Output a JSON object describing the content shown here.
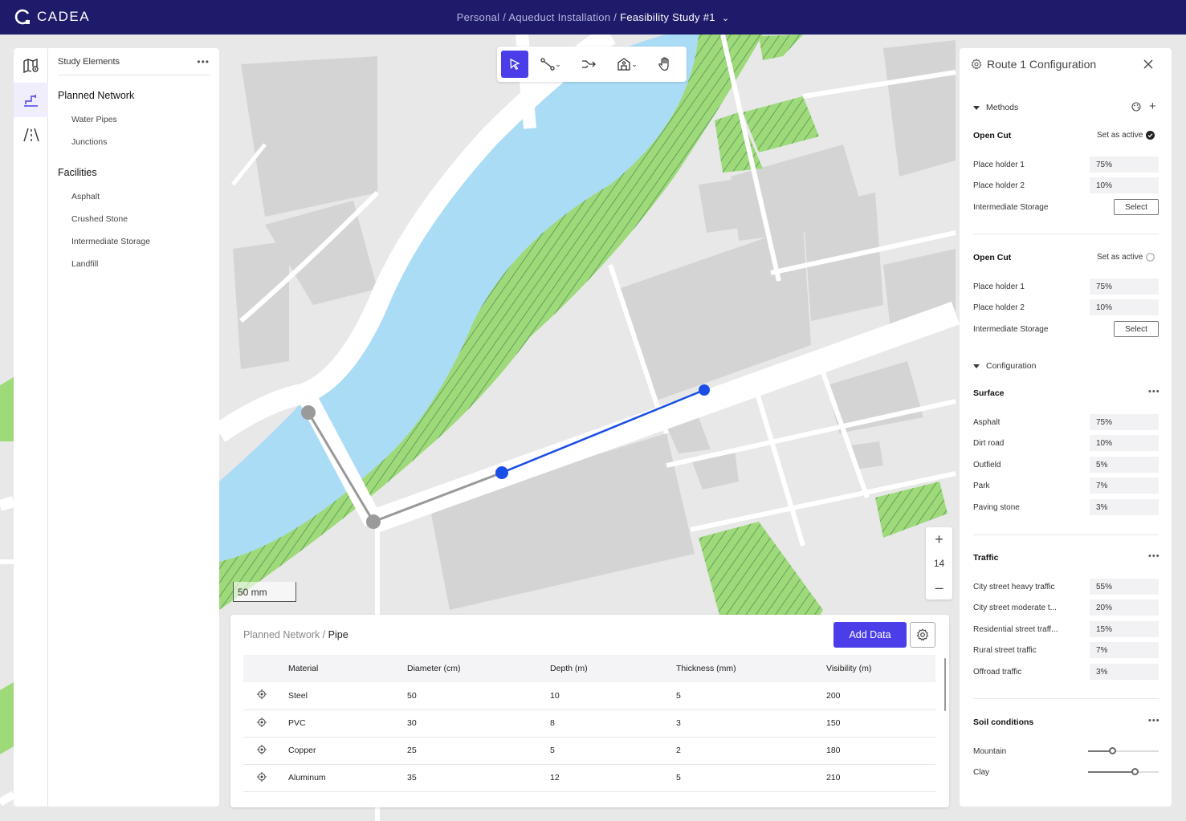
{
  "app": {
    "brand": "CADEA"
  },
  "breadcrumb": {
    "part1": "Personal",
    "sep": " / ",
    "part2": "Aqueduct Installation",
    "current": "Feasibility Study #1"
  },
  "study": {
    "title": "Study Elements",
    "groups": [
      {
        "label": "Planned Network",
        "items": [
          "Water Pipes",
          "Junctions"
        ]
      },
      {
        "label": "Facilities",
        "items": [
          "Asphalt",
          "Crushed Stone",
          "Intermediate Storage",
          "Landfill"
        ]
      }
    ]
  },
  "map": {
    "zoom_level": "14",
    "scale_label": "50 mm"
  },
  "data_panel": {
    "crumb_parent": "Planned Network",
    "crumb_sep": " / ",
    "crumb_current": "Pipe",
    "add_label": "Add Data",
    "columns": [
      "Material",
      "Diameter (cm)",
      "Depth (m)",
      "Thickness (mm)",
      "Visibility (m)"
    ],
    "rows": [
      [
        "Steel",
        "50",
        "10",
        "5",
        "200"
      ],
      [
        "PVC",
        "30",
        "8",
        "3",
        "150"
      ],
      [
        "Copper",
        "25",
        "5",
        "2",
        "180"
      ],
      [
        "Aluminum",
        "35",
        "12",
        "5",
        "210"
      ]
    ]
  },
  "config": {
    "title": "Route 1 Configuration",
    "methods_label": "Methods",
    "methods": [
      {
        "name": "Open Cut",
        "active_label": "Set as active",
        "active": true,
        "ph1_label": "Place holder 1",
        "ph1": "75%",
        "ph2_label": "Place holder 2",
        "ph2": "10%",
        "storage_label": "Intermediate Storage",
        "select_label": "Select"
      },
      {
        "name": "Open Cut",
        "active_label": "Set as active",
        "active": false,
        "ph1_label": "Place holder 1",
        "ph1": "75%",
        "ph2_label": "Place holder 2",
        "ph2": "10%",
        "storage_label": "Intermediate Storage",
        "select_label": "Select"
      }
    ],
    "configuration_label": "Configuration",
    "surface": {
      "title": "Surface",
      "items": [
        {
          "label": "Asphalt",
          "value": "75%"
        },
        {
          "label": "Dirt road",
          "value": "10%"
        },
        {
          "label": "Outfield",
          "value": "5%"
        },
        {
          "label": "Park",
          "value": "7%"
        },
        {
          "label": "Paving stone",
          "value": "3%"
        }
      ]
    },
    "traffic": {
      "title": "Traffic",
      "items": [
        {
          "label": "City street heavy traffic",
          "value": "55%"
        },
        {
          "label": "City street moderate t...",
          "value": "20%"
        },
        {
          "label": "Residential street traff...",
          "value": "15%"
        },
        {
          "label": "Rural street traffic",
          "value": "7%"
        },
        {
          "label": "Offroad traffic",
          "value": "3%"
        }
      ]
    },
    "soil": {
      "title": "Soil conditions",
      "items": [
        {
          "label": "Mountain",
          "level": 0.35
        },
        {
          "label": "Clay",
          "level": 0.67
        }
      ]
    }
  },
  "colors": {
    "accent": "#4b3ee8",
    "topbar": "#1f1b6b",
    "water": "#aadcf5",
    "park": "#9ed97a",
    "route": "#1a4ee6"
  }
}
